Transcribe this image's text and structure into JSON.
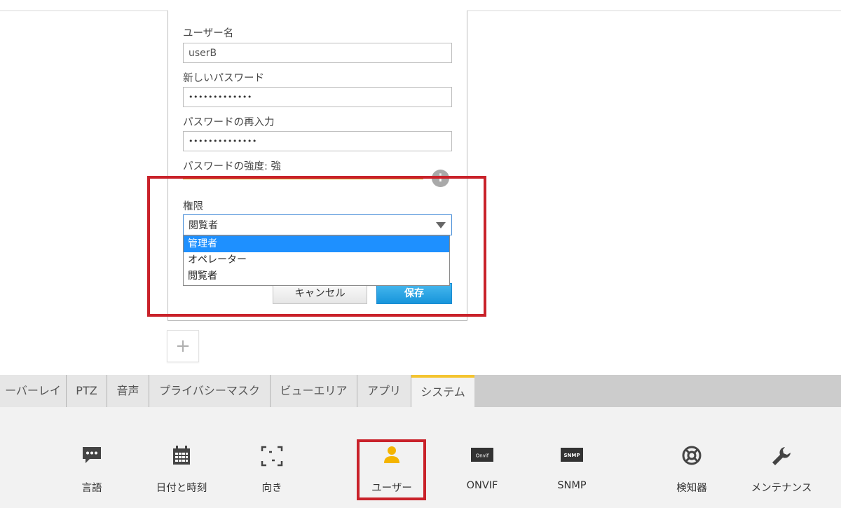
{
  "form": {
    "username_label": "ユーザー名",
    "username_value": "userB",
    "new_password_label": "新しいパスワード",
    "new_password_value": "•••••••••••••",
    "reenter_label": "パスワードの再入力",
    "reenter_value": "••••••••••••••",
    "strength_label": "パスワードの強度: 強",
    "info_icon_glyph": "i",
    "role_label": "権限",
    "role_selected": "閲覧者",
    "role_options": [
      "管理者",
      "オペレーター",
      "閲覧者"
    ],
    "cancel_label": "キャンセル",
    "save_label": "保存",
    "add_glyph": "+"
  },
  "tabs": [
    {
      "label": "ーバーレイ"
    },
    {
      "label": "PTZ"
    },
    {
      "label": "音声"
    },
    {
      "label": "プライバシーマスク"
    },
    {
      "label": "ビューエリア"
    },
    {
      "label": "アプリ"
    },
    {
      "label": "システム",
      "active": true
    }
  ],
  "system_menu": [
    {
      "label": "言語",
      "icon": "speech-bubble-icon"
    },
    {
      "label": "日付と時刻",
      "icon": "calendar-icon"
    },
    {
      "label": "向き",
      "icon": "orientation-icon"
    },
    {
      "label": "ユーザー",
      "icon": "user-icon",
      "active": true
    },
    {
      "label": "ONVIF",
      "icon": "onvif-logo-icon",
      "badge": "Onvif"
    },
    {
      "label": "SNMP",
      "icon": "snmp-icon",
      "badge": "SNMP"
    },
    {
      "label": "検知器",
      "icon": "detector-icon"
    },
    {
      "label": "メンテナンス",
      "icon": "wrench-icon"
    }
  ],
  "colors": {
    "accent_yellow": "#f4c430",
    "active_user_icon": "#f4b400",
    "select_highlight": "#1e90ff",
    "save_button": "#1795db",
    "annotation_red": "#c9222a",
    "strength_red": "#c9302c"
  }
}
